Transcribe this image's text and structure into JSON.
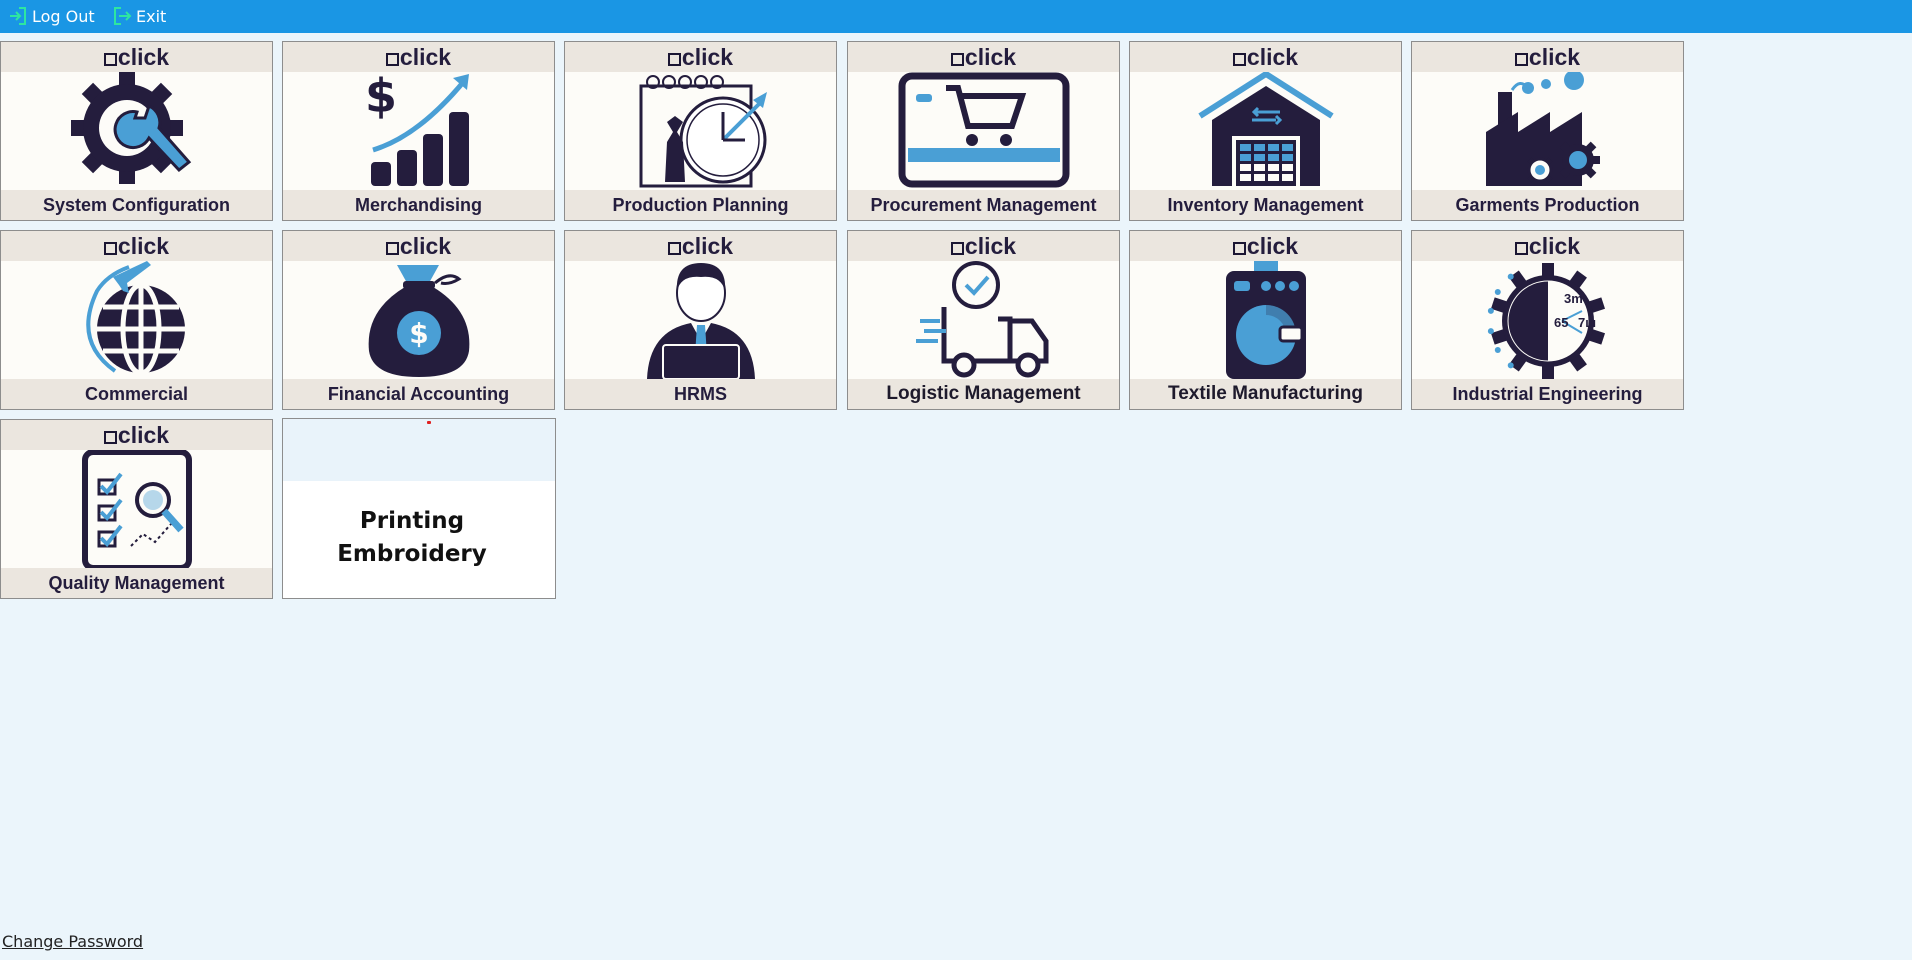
{
  "topbar": {
    "logout_label": "Log Out",
    "exit_label": "Exit",
    "icon_color": "#2ee6a0",
    "bg_color": "#1a96e4"
  },
  "brand": {
    "text": "click"
  },
  "modules": [
    {
      "label": "System Configuration",
      "icon": "gear-wrench-icon"
    },
    {
      "label": "Merchandising",
      "icon": "growth-chart-icon"
    },
    {
      "label": "Production Planning",
      "icon": "planning-clock-icon"
    },
    {
      "label": "Procurement Management",
      "icon": "shopping-cart-icon"
    },
    {
      "label": "Inventory Management",
      "icon": "warehouse-icon"
    },
    {
      "label": "Garments Production",
      "icon": "factory-icon"
    },
    {
      "label": "Commercial",
      "icon": "globe-plane-icon"
    },
    {
      "label": "Financial Accounting",
      "icon": "money-bag-icon"
    },
    {
      "label": "HRMS",
      "icon": "employee-icon"
    },
    {
      "label": "Logistic Management",
      "icon": "delivery-truck-icon"
    },
    {
      "label": "Textile Manufacturing",
      "icon": "washing-machine-icon"
    },
    {
      "label": "Industrial Engineering",
      "icon": "gear-measure-icon"
    },
    {
      "label": "Quality Management",
      "icon": "checklist-magnifier-icon"
    }
  ],
  "printing_tile": {
    "line1": "Printing",
    "line2": "Embroidery"
  },
  "industrial_icon_text": {
    "top": "3m",
    "left": "65",
    "right": "7ш"
  },
  "footer": {
    "change_password": "Change Password"
  },
  "colors": {
    "accent": "#4a9fd5",
    "dark": "#241d3d",
    "band": "#ebe6df"
  }
}
